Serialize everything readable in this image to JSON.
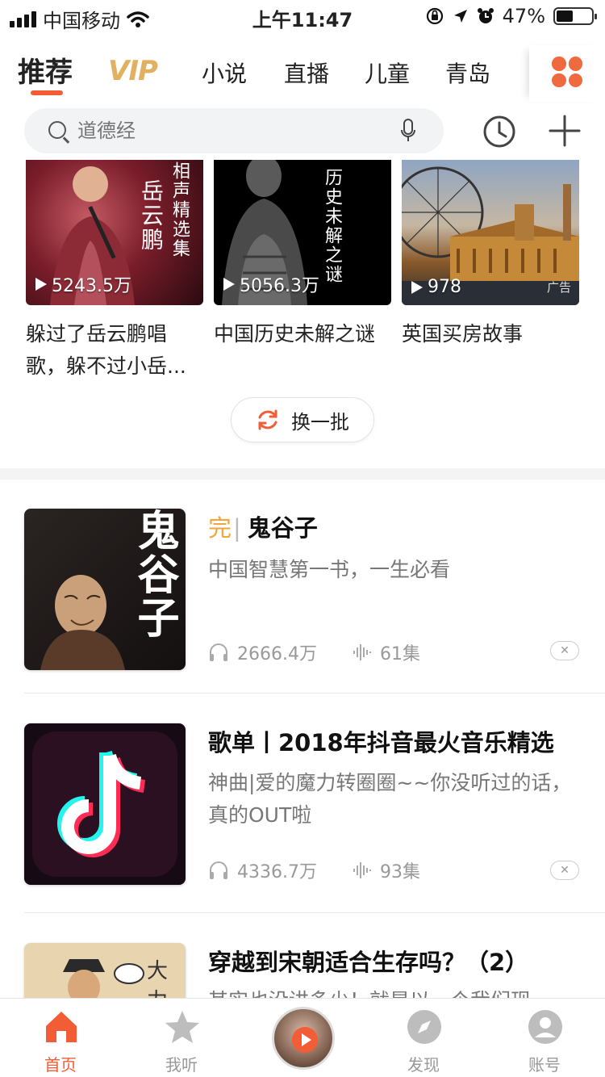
{
  "status_bar": {
    "carrier": "中国移动",
    "time": "上午11:47",
    "battery": "47%"
  },
  "tabs": {
    "items": [
      "推荐",
      "VIP",
      "小说",
      "直播",
      "儿童",
      "青岛"
    ],
    "active": "推荐"
  },
  "search": {
    "placeholder": "道德经"
  },
  "top_cards": [
    {
      "plays": "5243.5万",
      "title": "躲过了岳云鹏唱歌，躲不过小岳...",
      "cover_text_1": "岳云鹏",
      "cover_text_2": "相声精选集"
    },
    {
      "plays": "5056.3万",
      "title": "中国历史未解之谜",
      "cover_text_1": "历史未解之谜"
    },
    {
      "plays": "978",
      "title": "英国买房故事",
      "ad_label": "广告"
    }
  ],
  "refresh_label": "换一批",
  "list": [
    {
      "tag": "完",
      "title": "鬼谷子",
      "desc": "中国智慧第一书，一生必看",
      "plays": "2666.4万",
      "episodes": "61集",
      "cover_text": "鬼谷子"
    },
    {
      "title": "歌单丨2018年抖音最火音乐精选",
      "desc": "神曲|爱的魔力转圈圈~~你没听过的话，真的OUT啦",
      "plays": "4336.7万",
      "episodes": "93集"
    },
    {
      "title": "穿越到宋朝适合生存吗？（2）",
      "desc": "其实也没讲多少！就是以一个我们现",
      "cover_text": "大力"
    }
  ],
  "bottom_nav": [
    {
      "label": "首页",
      "icon": "home-icon",
      "active": true
    },
    {
      "label": "我听",
      "icon": "star-icon",
      "active": false
    },
    {
      "label": "",
      "icon": "play-icon",
      "active": false
    },
    {
      "label": "发现",
      "icon": "compass-icon",
      "active": false
    },
    {
      "label": "账号",
      "icon": "account-icon",
      "active": false
    }
  ],
  "colors": {
    "accent": "#f25d35",
    "vip_gold": "#e3b061",
    "finished_tag": "#f0a63a"
  }
}
